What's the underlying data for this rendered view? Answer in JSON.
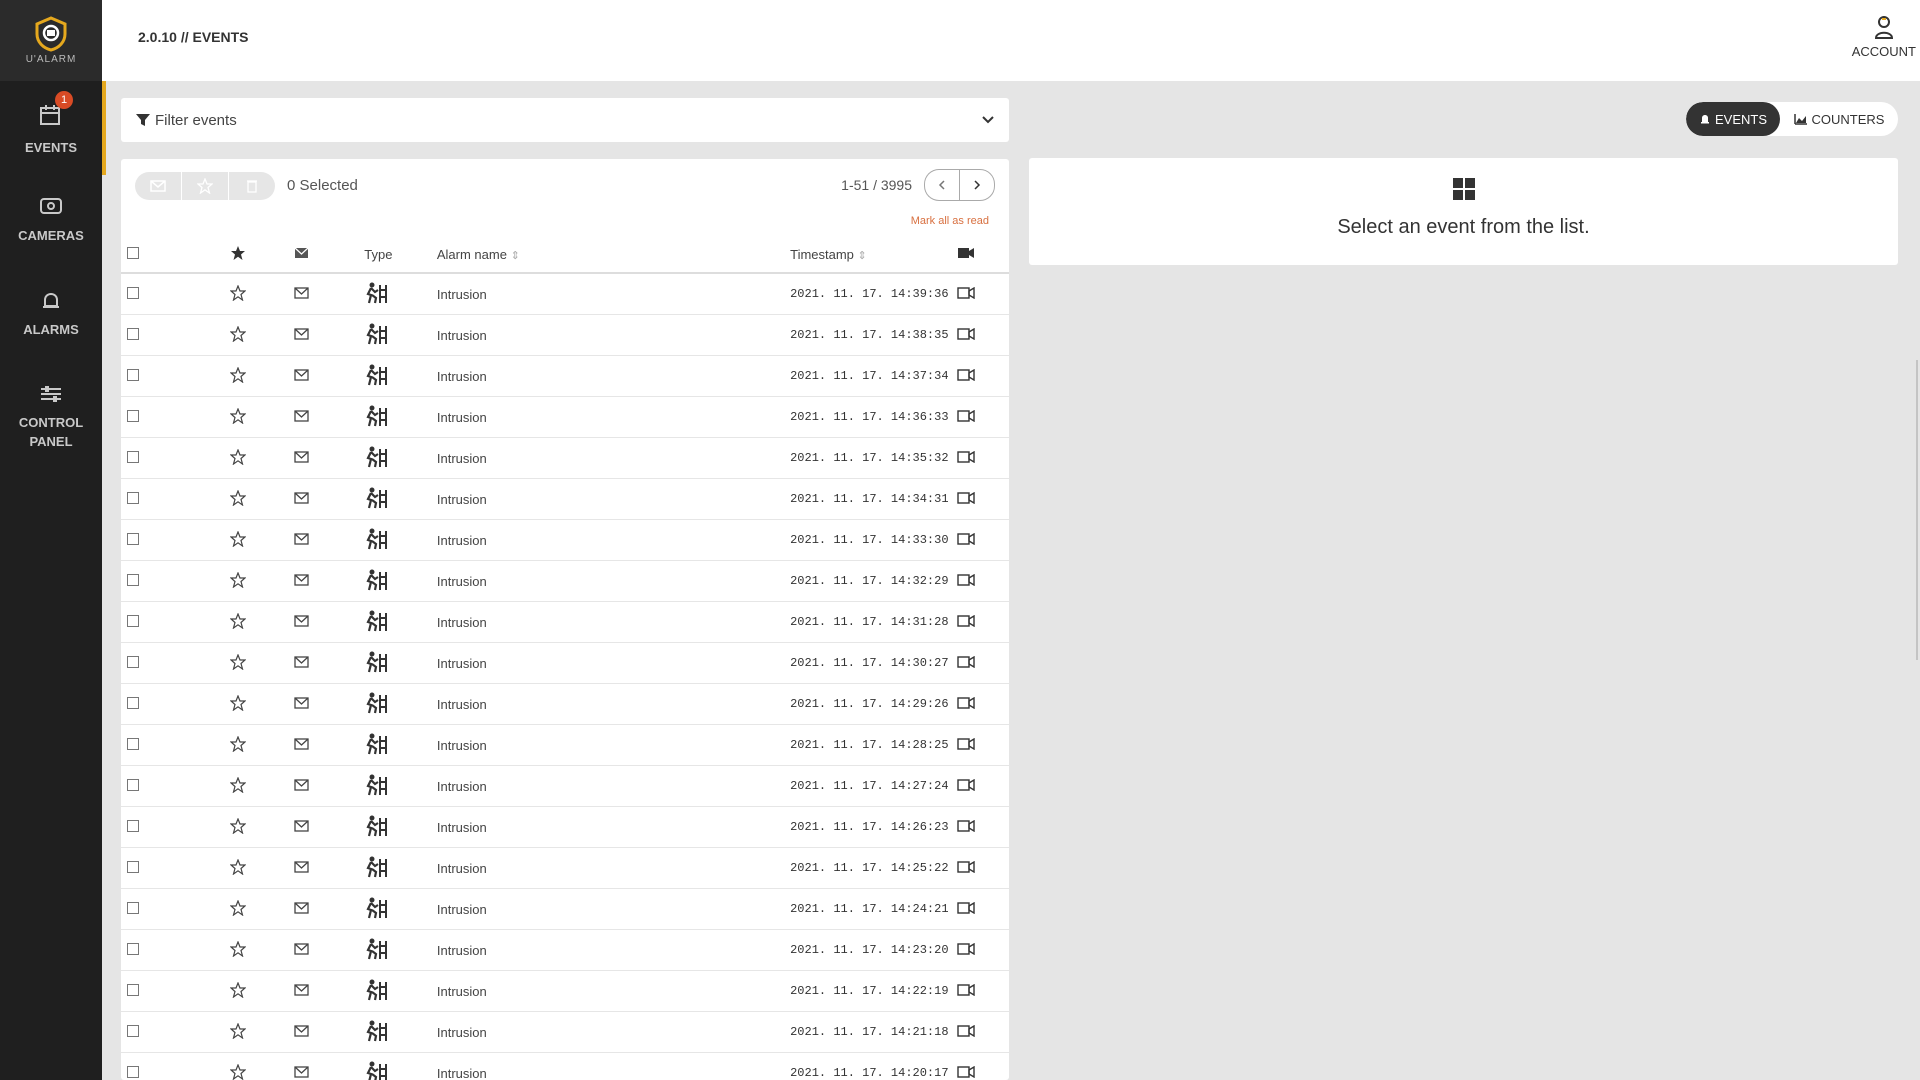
{
  "app": {
    "logo_text": "U'ALARM",
    "brand_color": "#e5a81e"
  },
  "header": {
    "breadcrumb": "2.0.10 // EVENTS",
    "account_label": "ACCOUNT"
  },
  "sidebar": {
    "items": [
      {
        "label_lines": [
          "EVENTS"
        ],
        "icon": "calendar-icon",
        "active": true,
        "badge": "1"
      },
      {
        "label_lines": [
          "CAMERAS"
        ],
        "icon": "camera-icon",
        "active": false
      },
      {
        "label_lines": [
          "ALARMS"
        ],
        "icon": "bell-icon",
        "active": false
      },
      {
        "label_lines": [
          "CONTROL",
          "PANEL"
        ],
        "icon": "sliders-icon",
        "active": false
      }
    ]
  },
  "filter": {
    "placeholder": "Filter events"
  },
  "view_toggle": {
    "events_label": "EVENTS",
    "counters_label": "COUNTERS"
  },
  "list": {
    "selected_label": "0 Selected",
    "pagination": "1-51 / 3995",
    "mark_all_read": "Mark all as read",
    "columns": {
      "type": "Type",
      "alarm_name": "Alarm name",
      "timestamp": "Timestamp"
    },
    "rows": [
      {
        "name": "Intrusion",
        "timestamp": "2021. 11. 17. 14:39:36"
      },
      {
        "name": "Intrusion",
        "timestamp": "2021. 11. 17. 14:38:35"
      },
      {
        "name": "Intrusion",
        "timestamp": "2021. 11. 17. 14:37:34"
      },
      {
        "name": "Intrusion",
        "timestamp": "2021. 11. 17. 14:36:33"
      },
      {
        "name": "Intrusion",
        "timestamp": "2021. 11. 17. 14:35:32"
      },
      {
        "name": "Intrusion",
        "timestamp": "2021. 11. 17. 14:34:31"
      },
      {
        "name": "Intrusion",
        "timestamp": "2021. 11. 17. 14:33:30"
      },
      {
        "name": "Intrusion",
        "timestamp": "2021. 11. 17. 14:32:29"
      },
      {
        "name": "Intrusion",
        "timestamp": "2021. 11. 17. 14:31:28"
      },
      {
        "name": "Intrusion",
        "timestamp": "2021. 11. 17. 14:30:27"
      },
      {
        "name": "Intrusion",
        "timestamp": "2021. 11. 17. 14:29:26"
      },
      {
        "name": "Intrusion",
        "timestamp": "2021. 11. 17. 14:28:25"
      },
      {
        "name": "Intrusion",
        "timestamp": "2021. 11. 17. 14:27:24"
      },
      {
        "name": "Intrusion",
        "timestamp": "2021. 11. 17. 14:26:23"
      },
      {
        "name": "Intrusion",
        "timestamp": "2021. 11. 17. 14:25:22"
      },
      {
        "name": "Intrusion",
        "timestamp": "2021. 11. 17. 14:24:21"
      },
      {
        "name": "Intrusion",
        "timestamp": "2021. 11. 17. 14:23:20"
      },
      {
        "name": "Intrusion",
        "timestamp": "2021. 11. 17. 14:22:19"
      },
      {
        "name": "Intrusion",
        "timestamp": "2021. 11. 17. 14:21:18"
      },
      {
        "name": "Intrusion",
        "timestamp": "2021. 11. 17. 14:20:17"
      }
    ]
  },
  "detail": {
    "message": "Select an event from the list."
  }
}
